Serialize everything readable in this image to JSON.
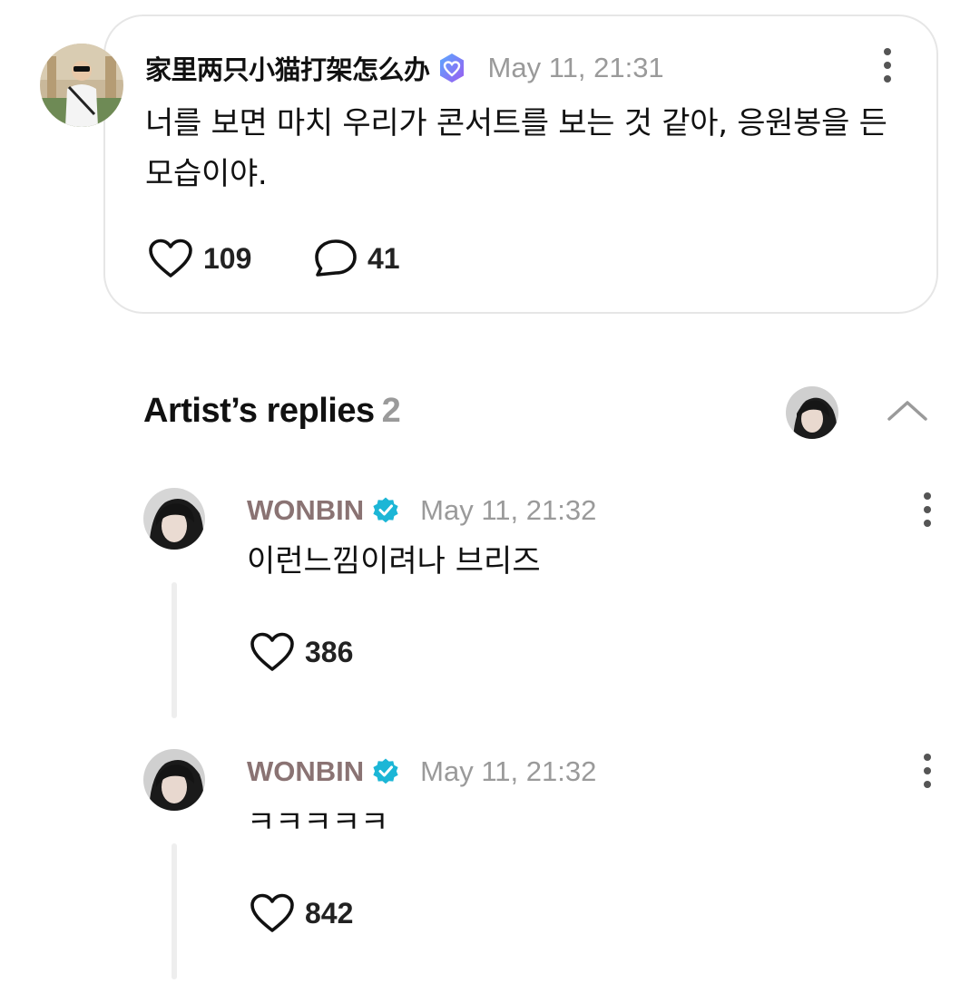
{
  "post": {
    "author": "家里两只小猫打架怎么办",
    "timestamp": "May 11, 21:31",
    "text": "너를 보면 마치 우리가 콘서트를 보는 것 같아, 응원봉을 든 모습이야.",
    "likes": "109",
    "comments": "41",
    "badge_color": "#7b6cf0"
  },
  "replies_section": {
    "title": "Artist’s replies",
    "count": "2"
  },
  "replies": [
    {
      "author": "WONBIN",
      "timestamp": "May 11, 21:32",
      "text": "이런느낌이려나 브리즈",
      "likes": "386"
    },
    {
      "author": "WONBIN",
      "timestamp": "May 11, 21:32",
      "text": "ㅋㅋㅋㅋㅋ",
      "likes": "842"
    }
  ],
  "colors": {
    "artist_name": "#8a7373",
    "verified_badge": "#1cb6d6",
    "muted_text": "#9a9a9a",
    "card_border": "#e6e6e6"
  },
  "icons": {
    "like": "heart-outline-icon",
    "comment": "speech-bubble-icon",
    "more": "vertical-ellipsis-icon",
    "collapse": "chevron-up-icon",
    "verified": "verified-badge-icon"
  }
}
